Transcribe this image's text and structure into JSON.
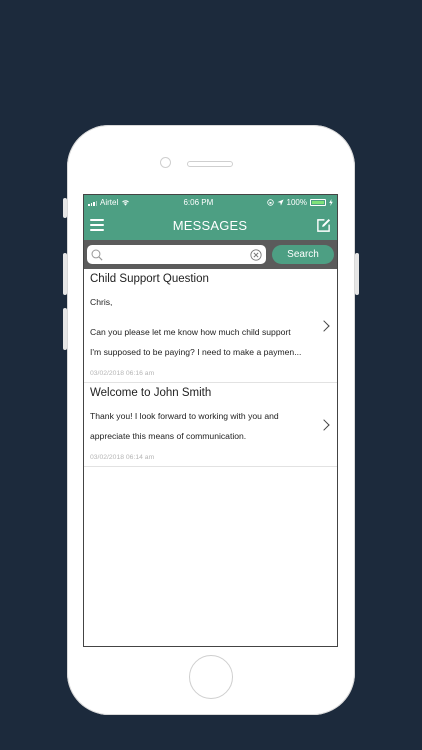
{
  "statusbar": {
    "carrier": "Airtel",
    "time": "6:06 PM",
    "battery": "100%"
  },
  "navbar": {
    "title": "MESSAGES"
  },
  "search": {
    "value": "",
    "placeholder": "",
    "button_label": "Search"
  },
  "messages": [
    {
      "title": "Child Support Question",
      "greeting": "Chris,",
      "body_line1": "Can you please let me know how much child support",
      "body_line2": "I'm supposed to be paying?  I need to make a paymen...",
      "date": "03/02/2018 06:16 am"
    },
    {
      "title": "Welcome to John Smith",
      "body_line1": "Thank you!  I look forward to working with you and",
      "body_line2": "appreciate this means of communication.",
      "date": "03/02/2018 06:14 am"
    }
  ],
  "colors": {
    "background": "#1c2a3c",
    "accent": "#4d9f83",
    "search_bar": "#5b5b5b"
  }
}
